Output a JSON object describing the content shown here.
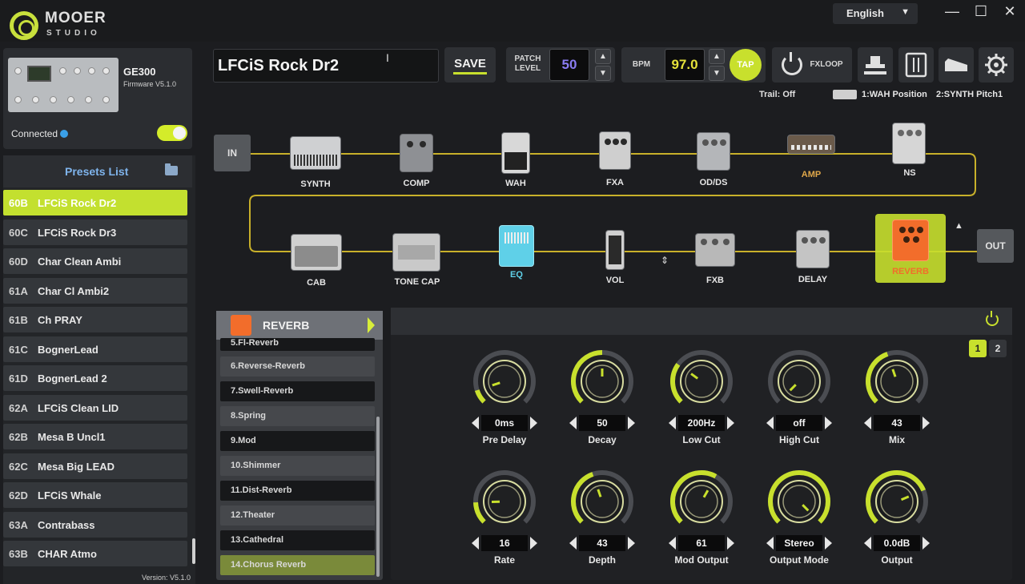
{
  "window": {
    "brand": "MOOER",
    "brand_sub": "STUDIO",
    "language": "English",
    "minimize": "—",
    "maximize": "☐",
    "close": "✕"
  },
  "device": {
    "name": "GE300",
    "firmware": "Firmware V5.1.0",
    "status": "Connected",
    "connected": true
  },
  "presets": {
    "title": "Presets List",
    "items": [
      {
        "id": "60B",
        "name": "LFCiS Rock Dr2",
        "selected": true
      },
      {
        "id": "60C",
        "name": "LFCiS Rock Dr3"
      },
      {
        "id": "60D",
        "name": "Char Clean Ambi"
      },
      {
        "id": "61A",
        "name": "Char Cl Ambi2"
      },
      {
        "id": "61B",
        "name": "Ch PRAY"
      },
      {
        "id": "61C",
        "name": "BognerLead"
      },
      {
        "id": "61D",
        "name": "BognerLead 2"
      },
      {
        "id": "62A",
        "name": "LFCiS Clean LID"
      },
      {
        "id": "62B",
        "name": "Mesa B Uncl1"
      },
      {
        "id": "62C",
        "name": "Mesa Big LEAD"
      },
      {
        "id": "62D",
        "name": "LFCiS Whale"
      },
      {
        "id": "63A",
        "name": "Contrabass"
      },
      {
        "id": "63B",
        "name": "CHAR Atmo"
      }
    ],
    "version": "Version: V5.1.0"
  },
  "patch": {
    "name": "LFCiS Rock Dr2",
    "save_label": "SAVE",
    "level_label": "PATCH LEVEL",
    "level_value": "50",
    "bpm_label": "BPM",
    "bpm_value": "97.0",
    "tap_label": "TAP",
    "fxloop_label": "FXLOOP",
    "trail": "Trail: Off",
    "expression1": "1:WAH Position",
    "expression2": "2:SYNTH Pitch1"
  },
  "chain": {
    "in_label": "IN",
    "out_label": "OUT",
    "row1": [
      "SYNTH",
      "COMP",
      "WAH",
      "FXA",
      "OD/DS",
      "AMP",
      "NS"
    ],
    "row2": [
      "CAB",
      "TONE CAP",
      "EQ",
      "VOL",
      "FXB",
      "DELAY",
      "REVERB"
    ],
    "active": "REVERB",
    "colors": {
      "accent": "#c8e02d",
      "eq_active": "#5fd0e8",
      "amp_label": "#e0a84a",
      "reverb": "#f26d2b"
    }
  },
  "fx_list": {
    "title": "REVERB",
    "items": [
      "5.Fl-Reverb",
      "6.Reverse-Reverb",
      "7.Swell-Reverb",
      "8.Spring",
      "9.Mod",
      "10.Shimmer",
      "11.Dist-Reverb",
      "12.Theater",
      "13.Cathedral",
      "14.Chorus Reverb"
    ],
    "selected": "14.Chorus Reverb"
  },
  "params": {
    "pages": [
      "1",
      "2"
    ],
    "active_page": "1",
    "knobs": [
      {
        "label": "Pre Delay",
        "value": "0ms",
        "level": 0.1
      },
      {
        "label": "Decay",
        "value": "50",
        "level": 0.5
      },
      {
        "label": "Low Cut",
        "value": "200Hz",
        "level": 0.3
      },
      {
        "label": "High Cut",
        "value": "off",
        "level": 0.0
      },
      {
        "label": "Mix",
        "value": "43",
        "level": 0.43
      },
      {
        "label": "Rate",
        "value": "16",
        "level": 0.16
      },
      {
        "label": "Depth",
        "value": "43",
        "level": 0.43
      },
      {
        "label": "Mod Output",
        "value": "61",
        "level": 0.61
      },
      {
        "label": "Output Mode",
        "value": "Stereo",
        "level": 1.0
      },
      {
        "label": "Output",
        "value": "0.0dB",
        "level": 0.75
      }
    ]
  }
}
